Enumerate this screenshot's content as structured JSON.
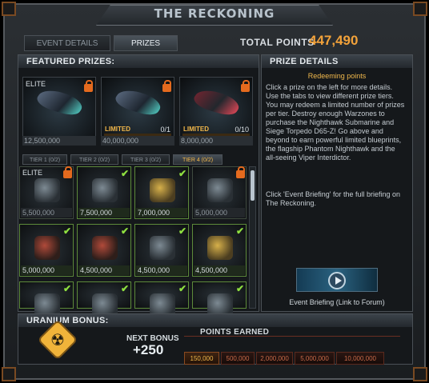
{
  "window": {
    "title": "THE RECKONING"
  },
  "tabs": [
    {
      "label": "EVENT DETAILS",
      "active": false
    },
    {
      "label": "PRIZES",
      "active": true
    }
  ],
  "total_points": {
    "label": "TOTAL POINTS",
    "value": "447,490"
  },
  "featured": {
    "heading": "FEATURED PRIZES:",
    "items": [
      {
        "tag": "ELITE",
        "limited": "",
        "count": "",
        "price": "12,500,000",
        "locked": true,
        "progress": 0
      },
      {
        "tag": "",
        "limited": "LIMITED",
        "count": "0/1",
        "price": "40,000,000",
        "locked": true,
        "progress": 0
      },
      {
        "tag": "",
        "limited": "LIMITED",
        "count": "0/10",
        "price": "8,000,000",
        "locked": true,
        "progress": 0
      }
    ]
  },
  "tiers": [
    {
      "label": "TIER 1 (0/2)",
      "active": false
    },
    {
      "label": "TIER 2 (0/2)",
      "active": false
    },
    {
      "label": "TIER 3 (0/2)",
      "active": false
    },
    {
      "label": "TIER 4 (0/2)",
      "active": true
    }
  ],
  "grid": [
    {
      "tag": "ELITE",
      "price": "5,500,000",
      "owned": false,
      "style": "gray"
    },
    {
      "tag": "",
      "price": "7,500,000",
      "owned": true,
      "style": "gray"
    },
    {
      "tag": "",
      "price": "7,000,000",
      "owned": true,
      "style": "gold"
    },
    {
      "tag": "",
      "price": "5,000,000",
      "owned": false,
      "style": "gray"
    },
    {
      "tag": "",
      "price": "5,000,000",
      "owned": true,
      "style": "red"
    },
    {
      "tag": "",
      "price": "4,500,000",
      "owned": true,
      "style": "red"
    },
    {
      "tag": "",
      "price": "4,500,000",
      "owned": true,
      "style": "gray"
    },
    {
      "tag": "",
      "price": "4,500,000",
      "owned": true,
      "style": "gold"
    },
    {
      "tag": "",
      "price": "",
      "owned": true,
      "style": "gray"
    },
    {
      "tag": "",
      "price": "",
      "owned": true,
      "style": "gray"
    },
    {
      "tag": "",
      "price": "",
      "owned": true,
      "style": "gray"
    },
    {
      "tag": "",
      "price": "",
      "owned": true,
      "style": "gray"
    }
  ],
  "details": {
    "heading": "PRIZE DETAILS",
    "title": "Redeeming points",
    "body": "Click a prize on the left for more details. Use the tabs to view different prize tiers. You may redeem a limited number of prizes per tier. Destroy enough Warzones to purchase the Nighthawk Submarine and Siege Torpedo D65-Z! Go above and beyond to earn powerful limited blueprints, the flagship Phantom Nighthawk and the all-seeing Viper Interdictor.",
    "briefing_text": "Click 'Event Briefing' for the full briefing on The Reckoning.",
    "briefing_link": "Event Briefing (Link to Forum)"
  },
  "uranium": {
    "heading": "URANIUM BONUS:",
    "next_bonus_label": "NEXT BONUS",
    "next_bonus_value": "+250",
    "points_earned_label": "POINTS EARNED",
    "milestones": [
      {
        "label": "150,000",
        "reached": true
      },
      {
        "label": "500,000",
        "reached": false
      },
      {
        "label": "2,000,000",
        "reached": false
      },
      {
        "label": "5,000,000",
        "reached": false
      },
      {
        "label": "10,000,000",
        "reached": false
      }
    ]
  },
  "colors": {
    "accent": "#f2a23a",
    "owned": "#8fe040",
    "lock": "#e46a1e"
  }
}
